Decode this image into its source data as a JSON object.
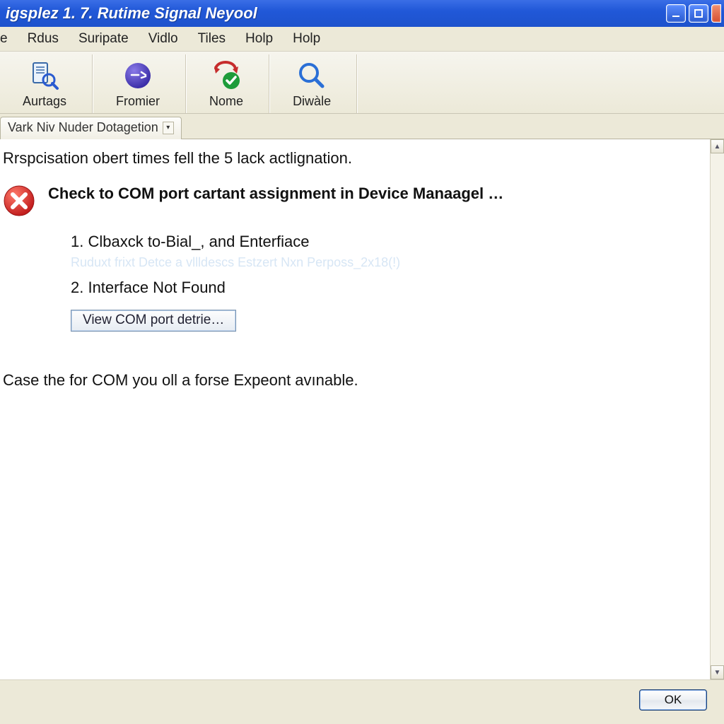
{
  "titlebar": {
    "title": "igsplez 1. 7. Rutime Signal Neyool"
  },
  "menubar": {
    "items": [
      "e",
      "Rdus",
      "Suripate",
      "Vidlo",
      "Tiles",
      "Holp",
      "Holp"
    ]
  },
  "toolbar": {
    "items": [
      {
        "label": "Aurtags",
        "icon": "document-search-icon"
      },
      {
        "label": "Fromier",
        "icon": "purple-sphere-icon"
      },
      {
        "label": "Nome",
        "icon": "refresh-check-icon"
      },
      {
        "label": "Diwàle",
        "icon": "magnifier-icon"
      }
    ]
  },
  "tab": {
    "label": "Vark Niv Nuder Dotagetion"
  },
  "content": {
    "intro": "Rrspcisation obert times fell the 5 lack actlignation.",
    "error_heading": "Check to COM port cartant assignment in Device Manaagel …",
    "list": {
      "item1": "1. Clbaxck to-Bial_, and Enterfiace",
      "ghost": "Ruduxt frixt Detce a vllldescs Estzert Nxn Perposs_2x18(!)",
      "item2": "2. Interface Not Found"
    },
    "view_button": "View COM port detrie…",
    "bottom": "Case the for COM you oll a forse Expeont avınable."
  },
  "buttonbar": {
    "ok": "OK"
  }
}
